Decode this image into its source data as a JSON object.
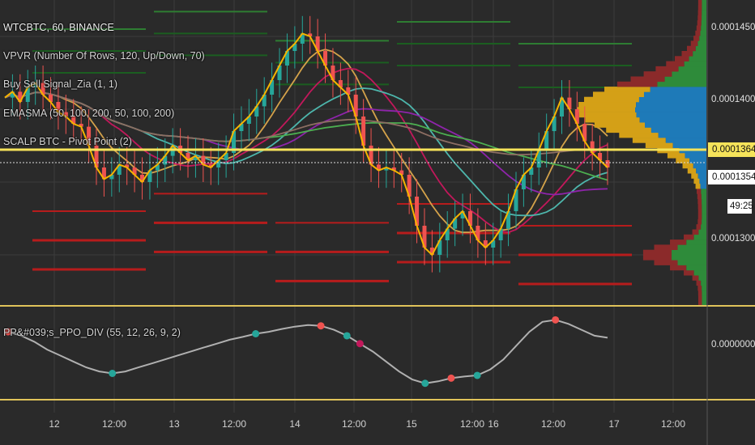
{
  "window": {
    "symbol_line": "WTCBTC, 60, BINANCE",
    "indicator_lines": [
      "VPVR (Number Of Rows, 120, Up/Down, 70)",
      "Buy Sell Signal_Zia (1, 1)",
      "EMASMA (50, 100, 200, 50, 100, 200)",
      "SCALP BTC - Pivot Point (2)"
    ],
    "oscillator_line": "PP&#039;s_PPO_DIV (55, 12, 26, 9, 2)"
  },
  "price_axis": {
    "labels": [
      "0.0001450",
      "0.0001400",
      "0.0001300"
    ],
    "current_price": "0.0001364",
    "secondary_price": "0.0001354",
    "countdown": "49:25",
    "oscillator_label": "0.0000000"
  },
  "time_axis": {
    "labels": [
      "12",
      "12:00",
      "13",
      "12:00",
      "14",
      "12:00",
      "15",
      "12:00",
      "16",
      "12:00",
      "17",
      "12:00"
    ]
  },
  "colors": {
    "background": "#2a2a2a",
    "grid": "#3c3c3c",
    "up_candle": "#26a69a",
    "down_candle": "#ef5350",
    "pivot_high": "#b71c1c",
    "pivot_low": "#1b5e20",
    "signal_line": "#f5b400",
    "price_line": "#f5e35a",
    "vpvr_up": "#2e8b3a",
    "vpvr_down": "#8b2a2a",
    "vpvr_value_up": "#1e7ab8",
    "vpvr_value_down": "#d4a017",
    "divider": "#e0c35a"
  },
  "chart_data": {
    "type": "candlestick",
    "x_ticks": [
      "12",
      "12:00",
      "13",
      "12:00",
      "14",
      "12:00",
      "15",
      "12:00",
      "16",
      "12:00",
      "17",
      "12:00"
    ],
    "price_ylim": [
      0.0001265,
      0.0001475
    ],
    "price_points": [
      0.0001408,
      0.0001412,
      0.0001405,
      0.0001415,
      0.0001418,
      0.000141,
      0.0001405,
      0.0001398,
      0.0001395,
      0.000139,
      0.0001388,
      0.0001375,
      0.000136,
      0.0001352,
      0.0001355,
      0.0001362,
      0.000136,
      0.0001355,
      0.000135,
      0.0001358,
      0.0001362,
      0.0001368,
      0.0001375,
      0.000137,
      0.0001365,
      0.0001368,
      0.0001362,
      0.000136,
      0.0001365,
      0.000137,
      0.0001385,
      0.000139,
      0.0001395,
      0.0001402,
      0.000141,
      0.000142,
      0.000143,
      0.000144,
      0.0001445,
      0.0001452,
      0.000145,
      0.000144,
      0.000143,
      0.000142,
      0.0001415,
      0.000141,
      0.0001395,
      0.0001375,
      0.0001362,
      0.0001358,
      0.000136,
      0.0001358,
      0.0001355,
      0.000134,
      0.000132,
      0.0001305,
      0.00013,
      0.000131,
      0.0001318,
      0.0001325,
      0.000133,
      0.000132,
      0.000131,
      0.0001305,
      0.000131,
      0.0001318,
      0.000133,
      0.0001345,
      0.0001355,
      0.000136,
      0.0001372,
      0.0001385,
      0.0001395,
      0.0001408,
      0.00014,
      0.000139,
      0.0001378,
      0.000137,
      0.0001365,
      0.000136
    ],
    "pivot_high_levels": [
      0.0001455,
      0.000144,
      0.0001425
    ],
    "pivot_low_levels": [
      0.000133,
      0.000131,
      0.000129
    ],
    "vpvr_profile": {
      "value_area": [
        0.0001345,
        0.0001415
      ],
      "poc": 0.00014
    },
    "oscillator": {
      "ylim": [
        -1,
        1
      ],
      "values": [
        0.55,
        0.45,
        0.3,
        0.1,
        -0.05,
        -0.2,
        -0.35,
        -0.45,
        -0.5,
        -0.45,
        -0.35,
        -0.25,
        -0.15,
        -0.05,
        0.05,
        0.15,
        0.25,
        0.35,
        0.42,
        0.5,
        0.55,
        0.62,
        0.68,
        0.72,
        0.7,
        0.6,
        0.45,
        0.25,
        0.05,
        -0.2,
        -0.45,
        -0.65,
        -0.75,
        -0.7,
        -0.62,
        -0.58,
        -0.55,
        -0.4,
        -0.15,
        0.2,
        0.55,
        0.8,
        0.85,
        0.75,
        0.6,
        0.45,
        0.4
      ]
    }
  }
}
